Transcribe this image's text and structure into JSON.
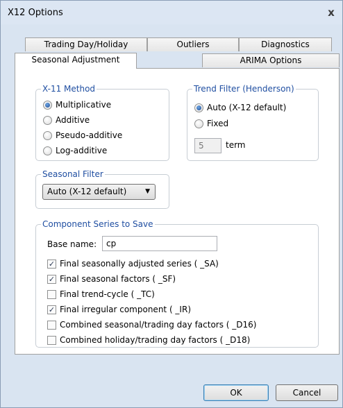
{
  "window": {
    "title": "X12 Options",
    "close_glyph": "x"
  },
  "tabs": {
    "back_row": [
      "Trading Day/Holiday",
      "Outliers",
      "Diagnostics"
    ],
    "front_row": [
      "Seasonal Adjustment",
      "ARIMA Options"
    ],
    "active": "Seasonal Adjustment"
  },
  "x11_method": {
    "legend": "X-11 Method",
    "options": [
      "Multiplicative",
      "Additive",
      "Pseudo-additive",
      "Log-additive"
    ],
    "selected": "Multiplicative"
  },
  "trend_filter": {
    "legend": "Trend Filter (Henderson)",
    "options": [
      "Auto (X-12 default)",
      "Fixed"
    ],
    "selected": "Auto (X-12 default)",
    "term_value": "5",
    "term_label": "term"
  },
  "seasonal_filter": {
    "legend": "Seasonal Filter",
    "selected": "Auto (X-12 default)"
  },
  "components": {
    "legend": "Component Series to Save",
    "base_name_label": "Base name:",
    "base_name_value": "cp",
    "items": [
      {
        "label": "Final seasonally adjusted series ( _SA)",
        "checked": true
      },
      {
        "label": "Final seasonal factors ( _SF)",
        "checked": true
      },
      {
        "label": "Final trend-cycle ( _TC)",
        "checked": false
      },
      {
        "label": "Final irregular component ( _IR)",
        "checked": true
      },
      {
        "label": "Combined seasonal/trading day factors ( _D16)",
        "checked": false
      },
      {
        "label": "Combined holiday/trading day factors ( _D18)",
        "checked": false
      }
    ]
  },
  "buttons": {
    "ok": "OK",
    "cancel": "Cancel"
  },
  "icons": {
    "radio_on": "radio-selected",
    "checkmark": "✓",
    "dropdown": "▼"
  },
  "colors": {
    "window_bg": "#d9e4f1",
    "legend_text": "#1f4ea1",
    "panel_bg": "#ffffff"
  }
}
